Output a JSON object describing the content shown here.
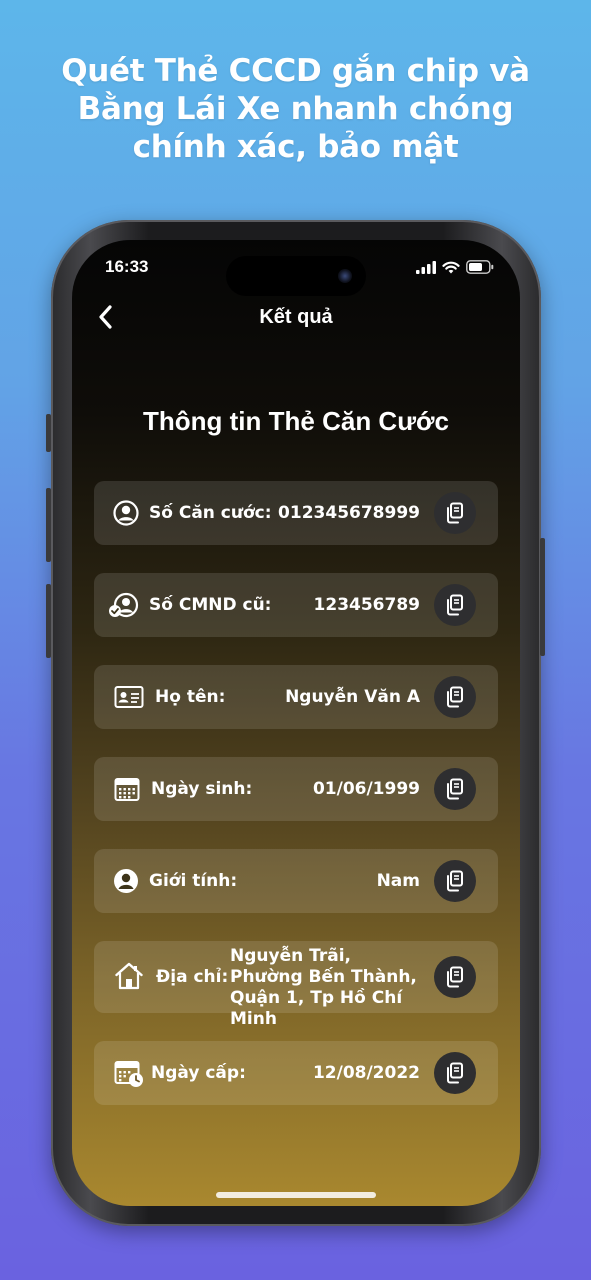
{
  "headline": {
    "line1": "Quét Thẻ CCCD gắn chip và",
    "line2": "Bằng Lái Xe nhanh chóng",
    "line3": "chính xác, bảo mật"
  },
  "status_bar": {
    "time": "16:33"
  },
  "nav": {
    "title": "Kết quả",
    "back_icon": "chevron-left-icon"
  },
  "section_title": "Thông tin Thẻ Căn Cước",
  "fields": [
    {
      "icon": "person-circle-icon",
      "label": "Số Căn cước:",
      "value": "012345678999"
    },
    {
      "icon": "person-check-icon",
      "label": "Số CMND cũ:",
      "value": "123456789"
    },
    {
      "icon": "id-card-icon",
      "label": "Họ tên:",
      "value": "Nguyễn Văn A"
    },
    {
      "icon": "calendar-icon",
      "label": "Ngày sinh:",
      "value": "01/06/1999"
    },
    {
      "icon": "person-circle-icon",
      "label": "Giới tính:",
      "value": "Nam"
    },
    {
      "icon": "home-icon",
      "label": "Địa chỉ:",
      "value": "Nguyễn Trãi, Phường Bến Thành, Quận 1, Tp Hồ Chí Minh"
    },
    {
      "icon": "calendar-clock-icon",
      "label": "Ngày cấp:",
      "value": "12/08/2022"
    }
  ],
  "colors": {
    "background_top": "#5db6ea",
    "background_bottom": "#6a62e0",
    "screen_top": "#050505",
    "screen_bottom": "#a9882f",
    "copy_button": "#2e2e30"
  }
}
